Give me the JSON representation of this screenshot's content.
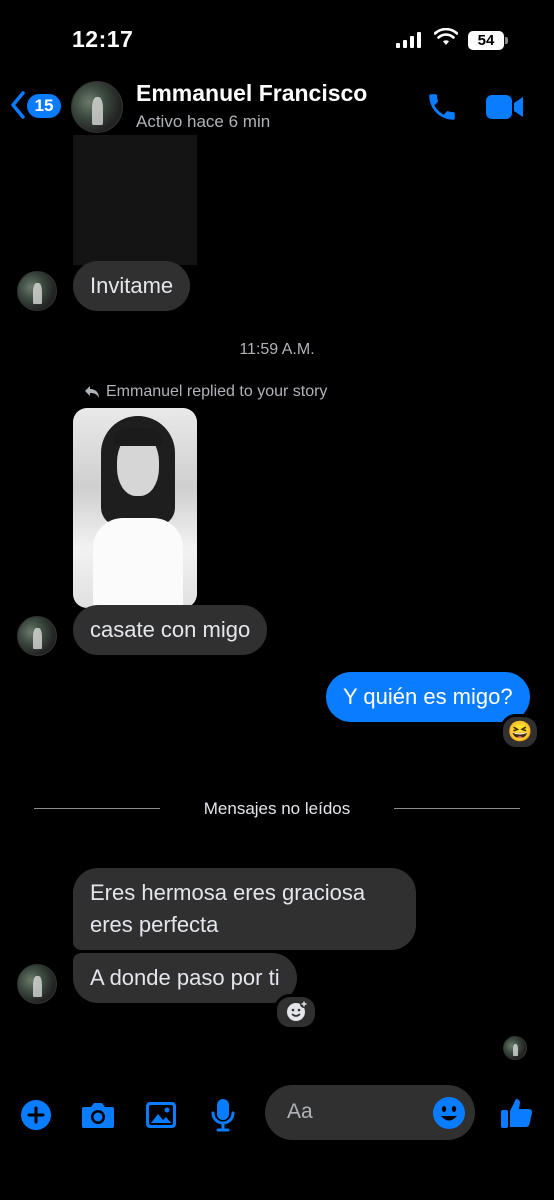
{
  "status_bar": {
    "time": "12:17",
    "battery": "54"
  },
  "header": {
    "back_badge": "15",
    "contact_name": "Emmanuel Francisco",
    "presence": "Activo hace 6 min"
  },
  "messages": {
    "invitame": "Invitame",
    "timestamp": "11:59 A.M.",
    "reply_note": "Emmanuel replied to your story",
    "casate": "casate con migo",
    "outgoing": "Y quién es migo?",
    "outgoing_reaction": "😆",
    "unread_divider": "Mensajes no leídos",
    "eres_line1": "Eres hermosa eres graciosa",
    "eres_line2": "eres perfecta",
    "adonde": "A donde paso por ti"
  },
  "composer": {
    "placeholder": "Aa"
  },
  "colors": {
    "accent": "#0a7cff",
    "incoming_bubble": "#303030",
    "background": "#000000"
  },
  "icons": [
    "back-chevron-icon",
    "phone-icon",
    "video-icon",
    "plus-icon",
    "camera-icon",
    "gallery-icon",
    "mic-icon",
    "emoji-icon",
    "thumbs-up-icon",
    "reply-arrow-icon",
    "add-reaction-icon"
  ]
}
